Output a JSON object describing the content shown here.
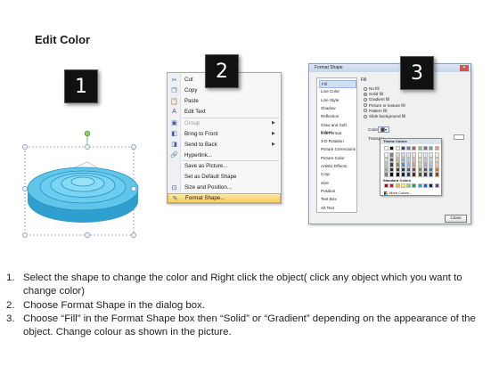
{
  "title": "Edit Color",
  "badges": [
    "1",
    "2",
    "3"
  ],
  "context_menu": {
    "items": [
      {
        "label": "Cut",
        "icon": "cut-icon",
        "glyph": "✂",
        "arrow": false,
        "disabled": false,
        "highlighted": false
      },
      {
        "label": "Copy",
        "icon": "copy-icon",
        "glyph": "❐",
        "arrow": false,
        "disabled": false,
        "highlighted": false
      },
      {
        "label": "Paste",
        "icon": "paste-icon",
        "glyph": "📋",
        "arrow": false,
        "disabled": false,
        "highlighted": false
      },
      {
        "label": "Edit Text",
        "icon": "edit-text-icon",
        "glyph": "A",
        "arrow": false,
        "disabled": false,
        "highlighted": false
      },
      {
        "label": "Group",
        "icon": "group-icon",
        "glyph": "▣",
        "arrow": true,
        "disabled": true,
        "highlighted": false
      },
      {
        "label": "Bring to Front",
        "icon": "bring-to-front-icon",
        "glyph": "◧",
        "arrow": true,
        "disabled": false,
        "highlighted": false
      },
      {
        "label": "Send to Back",
        "icon": "send-to-back-icon",
        "glyph": "◨",
        "arrow": true,
        "disabled": false,
        "highlighted": false
      },
      {
        "label": "Hyperlink...",
        "icon": "hyperlink-icon",
        "glyph": "🔗",
        "arrow": false,
        "disabled": false,
        "highlighted": false
      },
      {
        "label": "Save as Picture...",
        "icon": "",
        "glyph": "",
        "arrow": false,
        "disabled": false,
        "highlighted": false
      },
      {
        "label": "Set as Default Shape",
        "icon": "",
        "glyph": "",
        "arrow": false,
        "disabled": false,
        "highlighted": false
      },
      {
        "label": "Size and Position...",
        "icon": "size-position-icon",
        "glyph": "⊡",
        "arrow": false,
        "disabled": false,
        "highlighted": false
      },
      {
        "label": "Format Shape...",
        "icon": "format-shape-icon",
        "glyph": "✎",
        "arrow": false,
        "disabled": false,
        "highlighted": true
      }
    ]
  },
  "format_dialog": {
    "title": "Format Shape",
    "close_glyph": "✕",
    "nav": [
      "Fill",
      "Line Color",
      "Line Style",
      "Shadow",
      "Reflection",
      "Glow and Soft Edges",
      "3-D Format",
      "3-D Rotation",
      "Picture Corrections",
      "Picture Color",
      "Artistic Effects",
      "Crop",
      "Size",
      "Position",
      "Text Box",
      "Alt Text"
    ],
    "fill_heading": "Fill",
    "fill_options": [
      "No fill",
      "Solid fill",
      "Gradient fill",
      "Picture or texture fill",
      "Pattern fill",
      "Slide background fill"
    ],
    "selected_fill": 1,
    "color_label": "Color:",
    "transparency_label": "Transpar",
    "close_button": "Close"
  },
  "palette": {
    "theme_heading": "Theme Colors",
    "standard_heading": "Standard Colors",
    "more_colors": "More Colors...",
    "theme_top": [
      "#ffffff",
      "#000000",
      "#eeece1",
      "#1f497d",
      "#4f81bd",
      "#c0504d",
      "#9bbb59",
      "#8064a2",
      "#4bacc6",
      "#f79646"
    ],
    "theme_shades": [
      [
        "#f2f2f2",
        "#7f7f7f",
        "#ddd9c3",
        "#c6d9f0",
        "#dbe5f1",
        "#f2dcdb",
        "#ebf1dd",
        "#e5e0ec",
        "#dbeef3",
        "#fdeada"
      ],
      [
        "#d8d8d8",
        "#595959",
        "#c4bd97",
        "#8db3e2",
        "#b8cce4",
        "#e5b9b7",
        "#d7e3bc",
        "#ccc1d9",
        "#b7dde8",
        "#fbd5b5"
      ],
      [
        "#bfbfbf",
        "#3f3f3f",
        "#938953",
        "#548dd4",
        "#95b3d7",
        "#d99694",
        "#c3d69b",
        "#b2a2c7",
        "#92cddc",
        "#fac08f"
      ],
      [
        "#a5a5a5",
        "#262626",
        "#494429",
        "#17365d",
        "#366092",
        "#953734",
        "#76923c",
        "#5f497a",
        "#31859b",
        "#e36c09"
      ],
      [
        "#7f7f7f",
        "#0c0c0c",
        "#1d1b10",
        "#0f243e",
        "#244061",
        "#632423",
        "#4f6128",
        "#3f3151",
        "#205867",
        "#974806"
      ]
    ],
    "standard": [
      "#c00000",
      "#ff0000",
      "#ffc000",
      "#ffff00",
      "#92d050",
      "#00b050",
      "#00b0f0",
      "#0070c0",
      "#002060",
      "#7030a0"
    ]
  },
  "steps": [
    {
      "num": "1.",
      "text": "Select the shape to change the color and Right click the object( click any object which you want to change color)"
    },
    {
      "num": "2.",
      "text": "Choose Format Shape in the dialog box."
    },
    {
      "num": "3.",
      "text": "Choose “Fill” in the Format Shape box then “Solid” or “Gradient” depending on the appearance of the object. Change colour as shown in the picture."
    }
  ],
  "colors": {
    "shape_top": "#5fc6ea",
    "shape_side": "#2f9fcf",
    "highlight": "#f6cf58"
  }
}
